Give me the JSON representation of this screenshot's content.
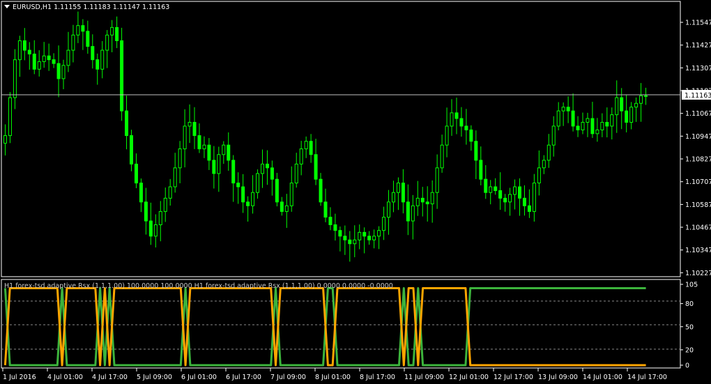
{
  "window": {
    "symbol_info": "EURUSD,H1  1.11155 1.11183 1.11147 1.11163",
    "current_price": "1.11163"
  },
  "indicator": {
    "label": "H1 forex-tsd adaptive Rsx (1,1,1.00) 100.0000 100.0000  H1 forex-tsd adaptive Rsx (1,1,1.00) 0.0000 0.0000 -0.0000"
  },
  "colors": {
    "background": "#000000",
    "candle": "#00ff00",
    "grid_frame": "#ffffff",
    "rsx_green": "#3cb43c",
    "rsx_orange": "#ffa500",
    "current_price_bg": "#ffffff"
  },
  "chart_data": [
    {
      "type": "candlestick",
      "symbol": "EURUSD",
      "timeframe": "H1",
      "ylim": [
        1.1021,
        1.1165
      ],
      "y_ticks": [
        "1.11547",
        "1.11427",
        "1.11307",
        "1.11187",
        "1.11067",
        "1.10947",
        "1.10827",
        "1.10707",
        "1.10587",
        "1.10467",
        "1.10347",
        "1.10227"
      ],
      "x_ticks": [
        "1 Jul 2016",
        "4 Jul 01:00",
        "4 Jul 17:00",
        "5 Jul 09:00",
        "6 Jul 01:00",
        "6 Jul 17:00",
        "7 Jul 09:00",
        "8 Jul 01:00",
        "8 Jul 17:00",
        "11 Jul 09:00",
        "12 Jul 01:00",
        "12 Jul 17:00",
        "13 Jul 09:00",
        "14 Jul 01:00",
        "14 Jul 17:00"
      ],
      "closes": [
        1.1095,
        1.1115,
        1.1135,
        1.1145,
        1.114,
        1.1138,
        1.113,
        1.1134,
        1.1137,
        1.1135,
        1.1133,
        1.1125,
        1.1132,
        1.114,
        1.1148,
        1.1153,
        1.115,
        1.1142,
        1.1135,
        1.113,
        1.114,
        1.1148,
        1.1152,
        1.1145,
        1.1108,
        1.1095,
        1.108,
        1.107,
        1.106,
        1.105,
        1.1042,
        1.1048,
        1.1055,
        1.1062,
        1.1068,
        1.1078,
        1.1088,
        1.11,
        1.1102,
        1.1095,
        1.1088,
        1.109,
        1.1082,
        1.1075,
        1.1085,
        1.109,
        1.1082,
        1.107,
        1.1068,
        1.106,
        1.1058,
        1.1065,
        1.1075,
        1.108,
        1.1078,
        1.1072,
        1.106,
        1.1055,
        1.1058,
        1.107,
        1.108,
        1.1088,
        1.1092,
        1.1085,
        1.1072,
        1.106,
        1.1052,
        1.1048,
        1.1045,
        1.1042,
        1.104,
        1.1038,
        1.104,
        1.1044,
        1.1042,
        1.104,
        1.1042,
        1.1045,
        1.1052,
        1.106,
        1.1065,
        1.107,
        1.106,
        1.105,
        1.1058,
        1.1062,
        1.106,
        1.1059,
        1.1065,
        1.1078,
        1.109,
        1.11,
        1.1107,
        1.1104,
        1.11,
        1.1098,
        1.1092,
        1.1082,
        1.1072,
        1.1065,
        1.1068,
        1.1066,
        1.1062,
        1.106,
        1.1064,
        1.1068,
        1.1062,
        1.1058,
        1.1055,
        1.107,
        1.1078,
        1.1082,
        1.109,
        1.11,
        1.1108,
        1.111,
        1.1108,
        1.11,
        1.1098,
        1.1102,
        1.1104,
        1.1096,
        1.1098,
        1.1102,
        1.11,
        1.1106,
        1.1115,
        1.1108,
        1.1102,
        1.111,
        1.1112,
        1.1116,
        1.1116
      ]
    },
    {
      "type": "line",
      "ylim": [
        0,
        105
      ],
      "y_ticks": [
        "105",
        "80",
        "50",
        "20",
        "0"
      ],
      "series": [
        {
          "color": "#3cb43c",
          "values": [
            100,
            0,
            0,
            0,
            0,
            0,
            0,
            0,
            0,
            0,
            0,
            0,
            100,
            0,
            0,
            0,
            0,
            0,
            0,
            0,
            100,
            0,
            100,
            0,
            0,
            0,
            0,
            0,
            0,
            0,
            0,
            0,
            0,
            0,
            0,
            0,
            0,
            0,
            100,
            0,
            0,
            0,
            0,
            0,
            0,
            0,
            0,
            0,
            0,
            0,
            0,
            0,
            0,
            0,
            0,
            0,
            0,
            100,
            0,
            0,
            0,
            0,
            0,
            0,
            0,
            0,
            0,
            0,
            100,
            100,
            0,
            0,
            0,
            0,
            0,
            0,
            0,
            0,
            0,
            0,
            0,
            0,
            0,
            0,
            100,
            0,
            0,
            100,
            0,
            0,
            0,
            0,
            0,
            0,
            0,
            0,
            0,
            0,
            100,
            100,
            100,
            100,
            100,
            100,
            100,
            100,
            100,
            100,
            100,
            100,
            100,
            100,
            100,
            100,
            100,
            100,
            100,
            100,
            100,
            100,
            100,
            100,
            100,
            100,
            100,
            100,
            100,
            100,
            100,
            100,
            100,
            100,
            100,
            100,
            100,
            100
          ]
        },
        {
          "color": "#ffa500",
          "values": [
            0,
            100,
            100,
            100,
            100,
            100,
            100,
            100,
            100,
            100,
            100,
            100,
            0,
            100,
            100,
            100,
            100,
            100,
            100,
            100,
            0,
            100,
            0,
            100,
            100,
            100,
            100,
            100,
            100,
            100,
            100,
            100,
            100,
            100,
            100,
            100,
            100,
            100,
            0,
            100,
            100,
            100,
            100,
            100,
            100,
            100,
            100,
            100,
            100,
            100,
            100,
            100,
            100,
            100,
            100,
            100,
            100,
            0,
            100,
            100,
            100,
            100,
            100,
            100,
            100,
            100,
            100,
            100,
            0,
            0,
            100,
            100,
            100,
            100,
            100,
            100,
            100,
            100,
            100,
            100,
            100,
            100,
            100,
            100,
            0,
            100,
            100,
            0,
            100,
            100,
            100,
            100,
            100,
            100,
            100,
            100,
            100,
            100,
            0,
            0,
            0,
            0,
            0,
            0,
            0,
            0,
            0,
            0,
            0,
            0,
            0,
            0,
            0,
            0,
            0,
            0,
            0,
            0,
            0,
            0,
            0,
            0,
            0,
            0,
            0,
            0,
            0,
            0,
            0,
            0,
            0,
            0,
            0,
            0,
            0,
            0
          ]
        }
      ]
    }
  ]
}
